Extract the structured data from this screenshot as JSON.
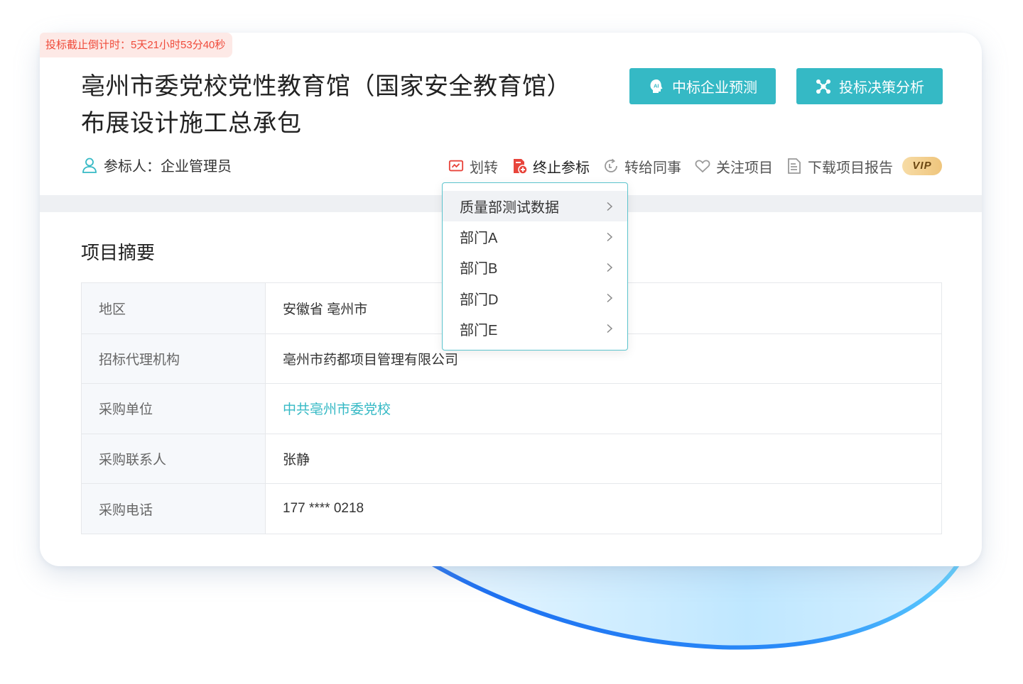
{
  "countdown": {
    "text": "投标截止倒计时：5天21小时53分40秒"
  },
  "project": {
    "title_line1": "亳州市委党校党性教育馆（国家安全教育馆）",
    "title_line2": "布展设计施工总承包"
  },
  "buttons": {
    "predict": {
      "label": "中标企业预测",
      "icon": "ai-bulb-icon"
    },
    "analysis": {
      "label": "投标决策分析",
      "icon": "network-icon"
    }
  },
  "participant": {
    "text": "参标人：企业管理员",
    "icon": "user-icon"
  },
  "actions": {
    "transfer": {
      "label": "划转",
      "icon": "transfer-icon"
    },
    "stop": {
      "label": "终止参标",
      "icon": "stop-bid-icon"
    },
    "forward": {
      "label": "转给同事",
      "icon": "forward-icon"
    },
    "follow": {
      "label": "关注项目",
      "icon": "heart-icon"
    },
    "download": {
      "label": "下载项目报告",
      "icon": "report-icon",
      "badge": "VIP"
    }
  },
  "summary": {
    "title": "项目摘要",
    "rows": [
      {
        "key": "地区",
        "value": "安徽省 亳州市"
      },
      {
        "key": "招标代理机构",
        "value": "亳州市药都项目管理有限公司"
      },
      {
        "key": "采购单位",
        "value": "中共亳州市委党校"
      },
      {
        "key": "采购联系人",
        "value": "张静"
      },
      {
        "key": "采购电话",
        "value": "177 **** 0218"
      }
    ]
  },
  "dropdown": {
    "items": [
      {
        "label": "质量部测试数据"
      },
      {
        "label": "部门A"
      },
      {
        "label": "部门B"
      },
      {
        "label": "部门D"
      },
      {
        "label": "部门E"
      }
    ]
  },
  "colors": {
    "accent": "#35b9c5",
    "countdown_text": "#f04a3a",
    "countdown_bg": "#fde9e6",
    "stop_icon": "#e8453c",
    "wave": "#1e6ff0"
  }
}
